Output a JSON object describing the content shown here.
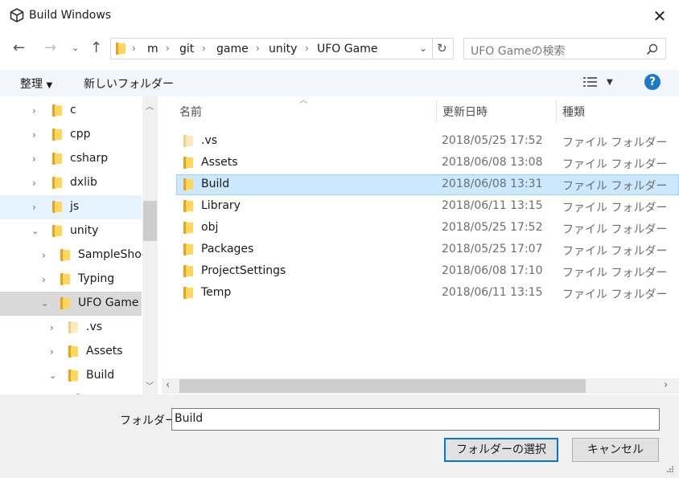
{
  "window": {
    "title": "Build Windows"
  },
  "address": {
    "crumbs": [
      "m",
      "git",
      "game",
      "unity",
      "UFO Game"
    ]
  },
  "search": {
    "placeholder": "UFO Gameの検索"
  },
  "toolbar": {
    "organize_label": "整理",
    "new_folder_label": "新しいフォルダー"
  },
  "nav": {
    "items": [
      {
        "label": "c"
      },
      {
        "label": "cpp"
      },
      {
        "label": "csharp"
      },
      {
        "label": "dxlib"
      },
      {
        "label": "js"
      },
      {
        "label": "unity"
      },
      {
        "label": "SampleShooting"
      },
      {
        "label": "Typing"
      },
      {
        "label": "UFO Game"
      },
      {
        "label": ".vs"
      },
      {
        "label": "Assets"
      },
      {
        "label": "Build"
      }
    ]
  },
  "columns": {
    "name": "名前",
    "date": "更新日時",
    "type": "種類"
  },
  "files": [
    {
      "name": ".vs",
      "date": "2018/05/25 17:52",
      "type": "ファイル フォルダー"
    },
    {
      "name": "Assets",
      "date": "2018/06/08 13:08",
      "type": "ファイル フォルダー"
    },
    {
      "name": "Build",
      "date": "2018/06/08 13:31",
      "type": "ファイル フォルダー"
    },
    {
      "name": "Library",
      "date": "2018/06/11 13:15",
      "type": "ファイル フォルダー"
    },
    {
      "name": "obj",
      "date": "2018/05/25 17:52",
      "type": "ファイル フォルダー"
    },
    {
      "name": "Packages",
      "date": "2018/05/25 17:07",
      "type": "ファイル フォルダー"
    },
    {
      "name": "ProjectSettings",
      "date": "2018/06/08 17:10",
      "type": "ファイル フォルダー"
    },
    {
      "name": "Temp",
      "date": "2018/06/11 13:15",
      "type": "ファイル フォルダー"
    }
  ],
  "footer": {
    "folder_label": "フォルダー:",
    "folder_value": "Build",
    "select_button": "フォルダーの選択",
    "cancel_button": "キャンセル"
  },
  "colors": {
    "selection": "#cce8ff",
    "selection_border": "#99d1ff",
    "hover": "#e5f3ff",
    "accent": "#0078d7",
    "help": "#1979ca"
  }
}
